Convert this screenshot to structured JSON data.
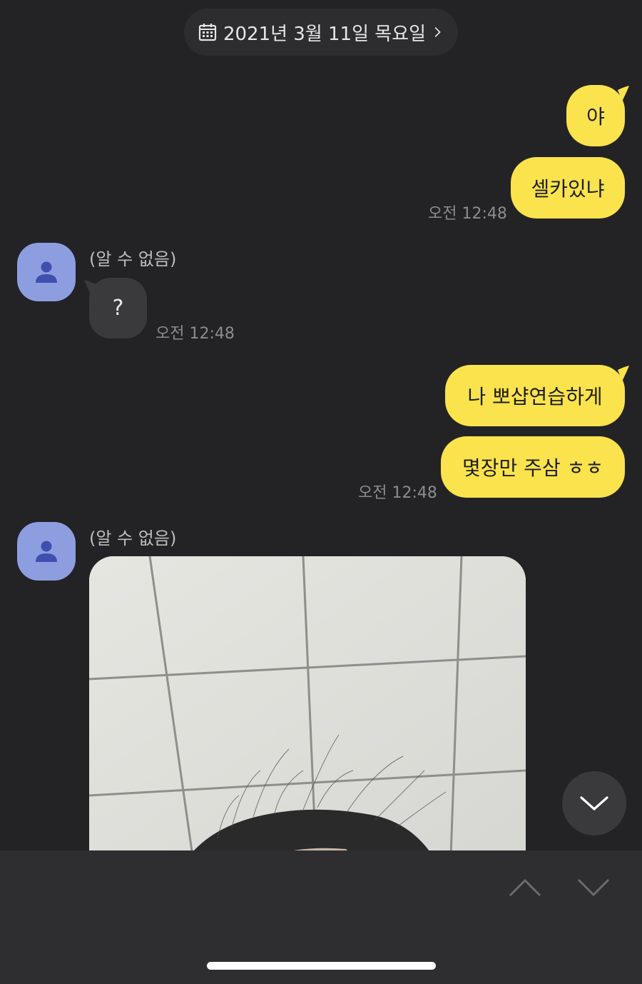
{
  "date_header": {
    "label": "2021년 3월 11일 목요일",
    "icon": "calendar-icon",
    "chevron": "chevron-right-icon"
  },
  "colors": {
    "my_bubble": "#fae34c",
    "other_bubble": "#3a3a3d",
    "background": "#232326",
    "avatar": "#8d9ee0"
  },
  "messages": {
    "m1": {
      "text": "야"
    },
    "m2": {
      "text": "셀카있냐",
      "time": "오전 12:48"
    },
    "m3": {
      "sender": "(알 수 없음)",
      "text": "?",
      "time": "오전 12:48"
    },
    "m4": {
      "text": "나 뽀샵연습하게"
    },
    "m5": {
      "text": "몇장만 주삼 ㅎㅎ",
      "time": "오전 12:48"
    },
    "m6": {
      "sender": "(알 수 없음)"
    }
  },
  "controls": {
    "scroll_down_icon": "chevron-down-icon",
    "prev_icon": "chevron-up-icon",
    "next_icon": "chevron-down-icon"
  }
}
